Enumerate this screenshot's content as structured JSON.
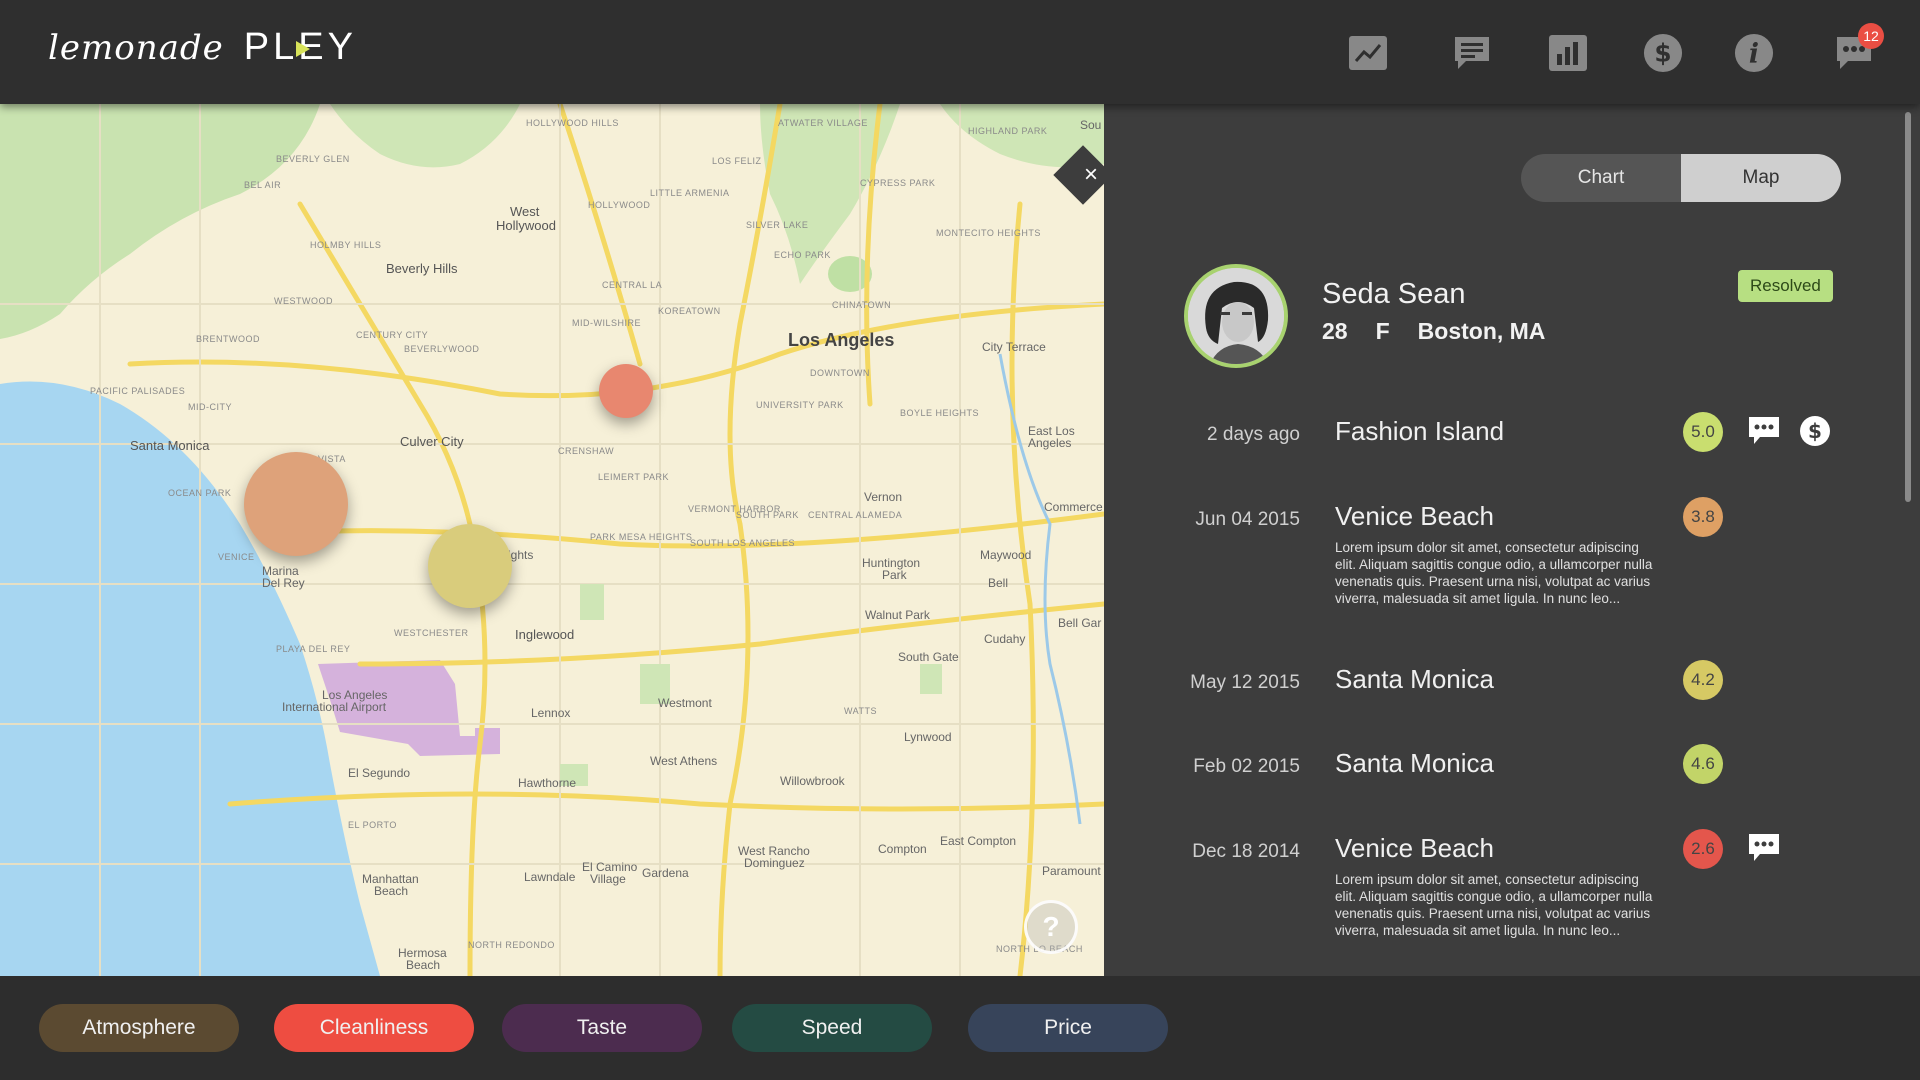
{
  "brand": {
    "script": "lemonade",
    "name": "PLEY"
  },
  "nav": {
    "icons": [
      "trend-chart-icon",
      "chat-icon",
      "bar-chart-icon",
      "dollar-icon",
      "info-icon",
      "messages-icon"
    ],
    "badge_count": "12"
  },
  "map": {
    "labels": {
      "los_angeles": "Los Angeles",
      "santa_monica": "Santa Monica",
      "beverly_hills": "Beverly Hills",
      "culver_city": "Culver City",
      "west_hollywood_1": "West",
      "west_hollywood_2": "Hollywood",
      "inglewood": "Inglewood",
      "marina_1": "Marina",
      "marina_2": "Del Rey",
      "lax_1": "Los Angeles",
      "lax_2": "International Airport",
      "el_segundo": "El Segundo",
      "hawthorne": "Hawthorne",
      "lennox": "Lennox",
      "westmont": "Westmont",
      "west_athens": "West Athens",
      "south_gate": "South Gate",
      "lynwood": "Lynwood",
      "compton": "Compton",
      "east_compton": "East Compton",
      "huntington_park_1": "Huntington",
      "huntington_park_2": "Park",
      "walnut_park": "Walnut Park",
      "cudahy": "Cudahy",
      "bell": "Bell",
      "maywood": "Maywood",
      "vernon": "Vernon",
      "commerce": "Commerce",
      "east_la_1": "East Los",
      "east_la_2": "Angeles",
      "city_terrace": "City Terrace",
      "bell_gardens": "Bell Gar",
      "paramount": "Paramount",
      "willowbrook": "Willowbrook",
      "gardena": "Gardena",
      "lawndale": "Lawndale",
      "el_camino_1": "El Camino",
      "el_camino_2": "Village",
      "manhattan_1": "Manhattan",
      "manhattan_2": "Beach",
      "hermosa_1": "Hermosa",
      "hermosa_2": "Beach",
      "west_rancho_1": "West Rancho",
      "west_rancho_2": "Dominguez",
      "heights": "ights",
      "hollywood_hills": "HOLLYWOOD HILLS",
      "beverly_glen": "BEVERLY GLEN",
      "bel_air": "BEL AIR",
      "holmby_hills": "HOLMBY HILLS",
      "westwood": "WESTWOOD",
      "brentwood": "BRENTWOOD",
      "century_city": "CENTURY CITY",
      "beverlywood": "BEVERLYWOOD",
      "pacific_palisades": "PACIFIC PALISADES",
      "mid_city": "MID-CITY",
      "ocean_park": "OCEAN PARK",
      "venice": "VENICE",
      "westchester": "WESTCHESTER",
      "playa_del_rey": "PLAYA DEL REY",
      "koreatown": "KOREATOWN",
      "central_la": "CENTRAL LA",
      "mid_wilshire": "MID-WILSHIRE",
      "downtown": "DOWNTOWN",
      "chinatown": "CHINATOWN",
      "echo_park": "ECHO PARK",
      "silver_lake": "SILVER LAKE",
      "los_feliz": "LOS FELIZ",
      "little_armenia": "LITTLE ARMENIA",
      "hollywood": "HOLLYWOOD",
      "atwater": "ATWATER VILLAGE",
      "highland_park": "HIGHLAND PARK",
      "cypress_park": "CYPRESS PARK",
      "montecito": "MONTECITO HEIGHTS",
      "boyle_heights": "BOYLE HEIGHTS",
      "university_park": "UNIVERSITY PARK",
      "crenshaw": "CRENSHAW",
      "leimert_park": "LEIMERT PARK",
      "park_mesa": "PARK MESA HEIGHTS",
      "vermont_harbor": "VERMONT HARBOR",
      "south_park": "SOUTH PARK",
      "central_alameda": "CENTRAL ALAMEDA",
      "south_la": "SOUTH LOS ANGELES",
      "watts": "WATTS",
      "el_porto": "EL PORTO",
      "north_redondo": "NORTH REDONDO",
      "north_long": "NORTH LO BEACH",
      "sou": "Sou",
      "mar_vista": "VISTA"
    },
    "bubbles": [
      {
        "name": "fashion-island-bubble",
        "color": "#e8876f"
      },
      {
        "name": "venice-beach-bubble",
        "color": "#dea27a"
      },
      {
        "name": "santa-monica-bubble",
        "color": "#d9cc7c"
      }
    ],
    "help_label": "?"
  },
  "panel": {
    "close_label": "×",
    "toggle": {
      "chart": "Chart",
      "map": "Map",
      "active": "Map"
    },
    "user": {
      "name": "Seda Sean",
      "age": "28",
      "gender": "F",
      "location": "Boston, MA",
      "status": "Resolved"
    },
    "reviews": [
      {
        "date": "2 days ago",
        "place": "Fashion Island",
        "score": "5.0",
        "score_color": "#c9de6f",
        "has_chat": true,
        "has_dollar": true,
        "body": ""
      },
      {
        "date": "Jun 04 2015",
        "place": "Venice Beach",
        "score": "3.8",
        "score_color": "#dea064",
        "has_chat": false,
        "has_dollar": false,
        "body": "Lorem ipsum dolor sit amet, consectetur adipiscing elit. Aliquam sagittis congue odio, a ullamcorper nulla venenatis quis. Praesent urna nisi, volutpat ac varius viverra, malesuada sit amet ligula. In nunc leo..."
      },
      {
        "date": "May 12 2015",
        "place": "Santa Monica",
        "score": "4.2",
        "score_color": "#d6c964",
        "has_chat": false,
        "has_dollar": false,
        "body": ""
      },
      {
        "date": "Feb 02 2015",
        "place": "Santa Monica",
        "score": "4.6",
        "score_color": "#c2d468",
        "has_chat": false,
        "has_dollar": false,
        "body": ""
      },
      {
        "date": "Dec 18 2014",
        "place": "Venice Beach",
        "score": "2.6",
        "score_color": "#e4564c",
        "has_chat": true,
        "has_dollar": false,
        "body": "Lorem ipsum dolor sit amet, consectetur adipiscing elit. Aliquam sagittis congue odio, a ullamcorper nulla venenatis quis. Praesent urna nisi, volutpat ac varius viverra, malesuada sit amet ligula. In nunc leo..."
      }
    ]
  },
  "filters": [
    {
      "label": "Atmosphere",
      "color": "#5b4a31"
    },
    {
      "label": "Cleanliness",
      "color": "#ee4d41"
    },
    {
      "label": "Taste",
      "color": "#4c2c4f"
    },
    {
      "label": "Speed",
      "color": "#244b43"
    },
    {
      "label": "Price",
      "color": "#37445a"
    }
  ]
}
